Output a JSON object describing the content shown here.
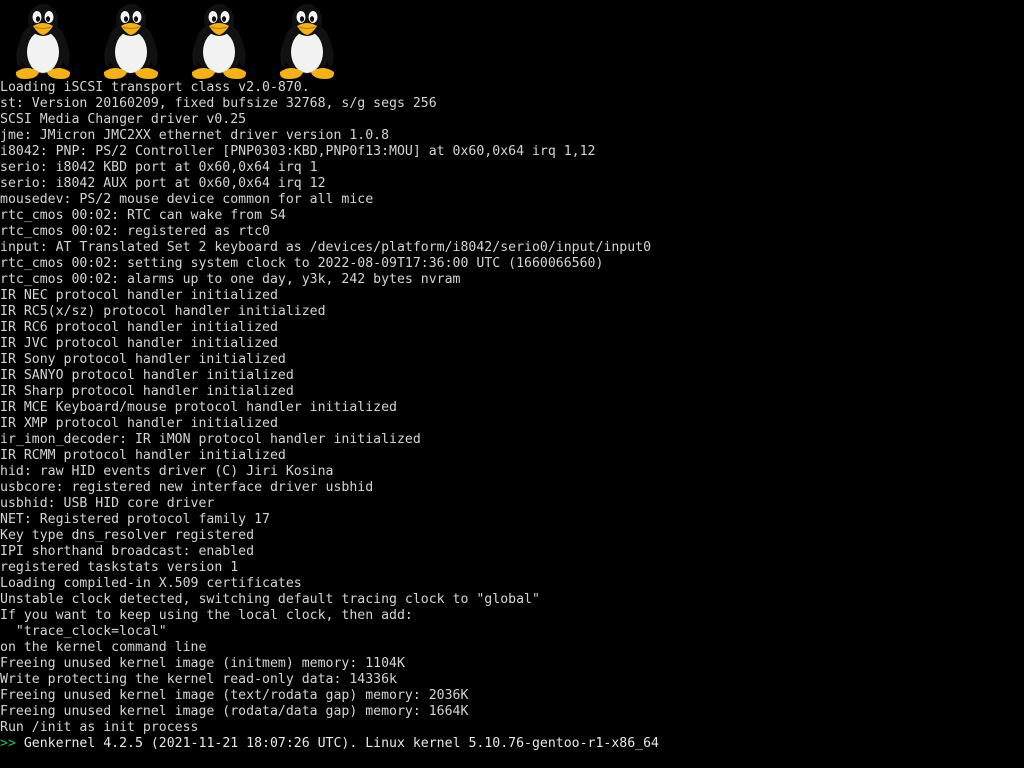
{
  "console": {
    "background_color": "#000000",
    "text_color": "#d4d4d4",
    "prompt_color": "#2ec05a",
    "logo": {
      "icon": "tux-penguin-icon",
      "count": 4
    },
    "lines": [
      "Loading iSCSI transport class v2.0-870.",
      "st: Version 20160209, fixed bufsize 32768, s/g segs 256",
      "SCSI Media Changer driver v0.25",
      "jme: JMicron JMC2XX ethernet driver version 1.0.8",
      "i8042: PNP: PS/2 Controller [PNP0303:KBD,PNP0f13:MOU] at 0x60,0x64 irq 1,12",
      "serio: i8042 KBD port at 0x60,0x64 irq 1",
      "serio: i8042 AUX port at 0x60,0x64 irq 12",
      "mousedev: PS/2 mouse device common for all mice",
      "rtc_cmos 00:02: RTC can wake from S4",
      "rtc_cmos 00:02: registered as rtc0",
      "input: AT Translated Set 2 keyboard as /devices/platform/i8042/serio0/input/input0",
      "rtc_cmos 00:02: setting system clock to 2022-08-09T17:36:00 UTC (1660066560)",
      "rtc_cmos 00:02: alarms up to one day, y3k, 242 bytes nvram",
      "IR NEC protocol handler initialized",
      "IR RC5(x/sz) protocol handler initialized",
      "IR RC6 protocol handler initialized",
      "IR JVC protocol handler initialized",
      "IR Sony protocol handler initialized",
      "IR SANYO protocol handler initialized",
      "IR Sharp protocol handler initialized",
      "IR MCE Keyboard/mouse protocol handler initialized",
      "IR XMP protocol handler initialized",
      "ir_imon_decoder: IR iMON protocol handler initialized",
      "IR RCMM protocol handler initialized",
      "hid: raw HID events driver (C) Jiri Kosina",
      "usbcore: registered new interface driver usbhid",
      "usbhid: USB HID core driver",
      "NET: Registered protocol family 17",
      "Key type dns_resolver registered",
      "IPI shorthand broadcast: enabled",
      "registered taskstats version 1",
      "Loading compiled-in X.509 certificates",
      "Unstable clock detected, switching default tracing clock to \"global\"",
      "If you want to keep using the local clock, then add:",
      "  \"trace_clock=local\"",
      "on the kernel command line",
      "Freeing unused kernel image (initmem) memory: 1104K",
      "Write protecting the kernel read-only data: 14336k",
      "Freeing unused kernel image (text/rodata gap) memory: 2036K",
      "Freeing unused kernel image (rodata/data gap) memory: 1664K",
      "Run /init as init process"
    ],
    "prompt": {
      "marker": ">>",
      "text": " Genkernel 4.2.5 (2021-11-21 18:07:26 UTC). Linux kernel 5.10.76-gentoo-r1-x86_64"
    }
  }
}
